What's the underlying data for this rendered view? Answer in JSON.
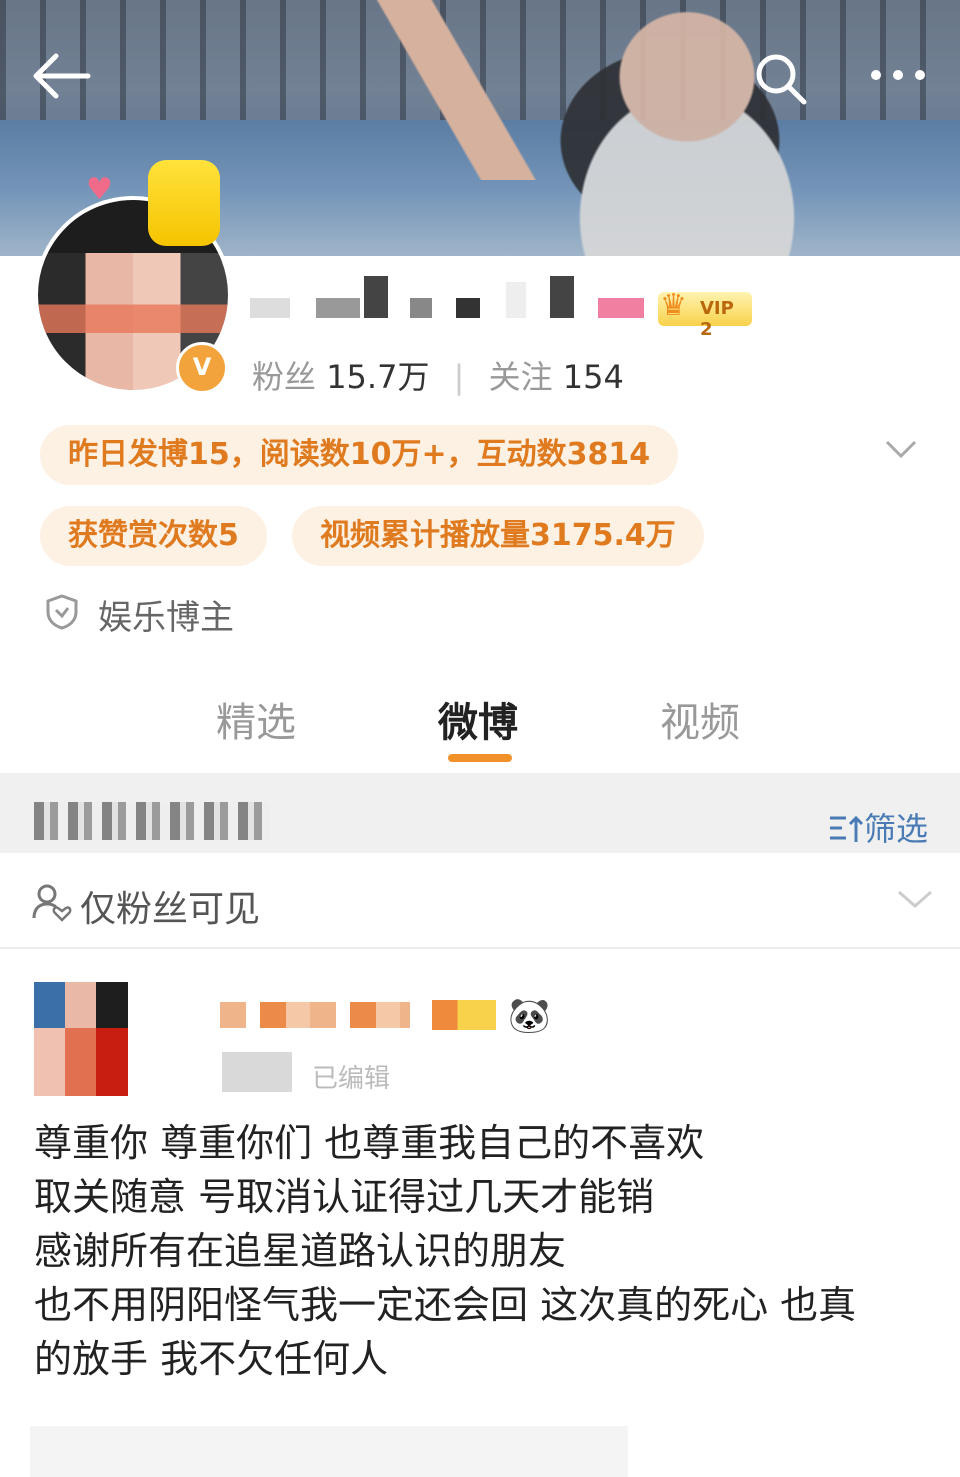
{
  "header": {
    "back_icon": "arrow-left-icon",
    "search_icon": "search-icon",
    "more_icon": "more-horizontal-icon"
  },
  "profile": {
    "vip_label": "VIP 2",
    "verified_symbol": "V",
    "stats": {
      "fans_label": "粉丝",
      "fans_value": "15.7万",
      "following_label": "关注",
      "following_value": "154"
    },
    "pills": [
      "昨日发博15，阅读数10万+，互动数3814",
      "获赞赏次数5",
      "视频累计播放量3175.4万"
    ],
    "category": "娱乐博主"
  },
  "tabs": [
    {
      "label": "精选",
      "active": false
    },
    {
      "label": "微博",
      "active": true
    },
    {
      "label": "视频",
      "active": false
    }
  ],
  "filter": {
    "label": "筛选"
  },
  "visibility": {
    "label": "仅粉丝可见"
  },
  "post": {
    "edited_label": "已编辑",
    "lines": [
      "尊重你 尊重你们 也尊重我自己的不喜欢",
      "取关随意  号取消认证得过几天才能销",
      "感谢所有在追星道路认识的朋友",
      "也不用阴阳怪气我一定还会回 这次真的死心 也真",
      "的放手 我不欠任何人"
    ]
  },
  "colors": {
    "accent_orange": "#f2902a",
    "pill_bg": "#fdf1e4",
    "pill_text": "#e07a1f",
    "filter_blue": "#4a7bb5"
  }
}
